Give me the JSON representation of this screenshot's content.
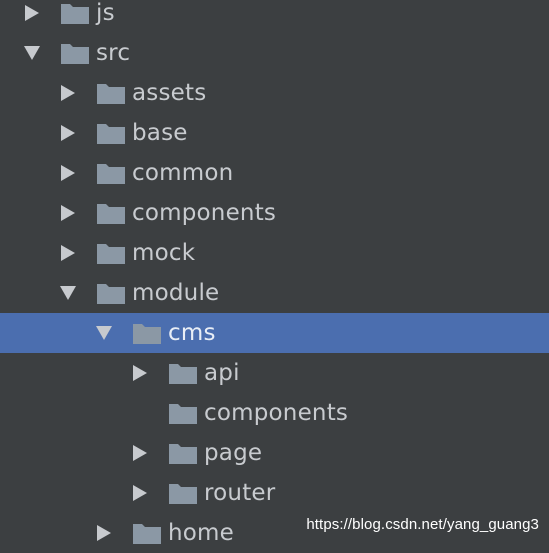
{
  "colors": {
    "background": "#3c3f41",
    "selection": "#4b6eaf",
    "folder": "#8b98a5",
    "arrow": "#c7cace",
    "text": "#c8cbcf"
  },
  "tree": [
    {
      "label": "js",
      "depth": 0,
      "expander": "collapsed",
      "selected": false,
      "icon": "folder-icon"
    },
    {
      "label": "src",
      "depth": 0,
      "expander": "expanded",
      "selected": false,
      "icon": "folder-icon"
    },
    {
      "label": "assets",
      "depth": 1,
      "expander": "collapsed",
      "selected": false,
      "icon": "folder-icon"
    },
    {
      "label": "base",
      "depth": 1,
      "expander": "collapsed",
      "selected": false,
      "icon": "folder-icon"
    },
    {
      "label": "common",
      "depth": 1,
      "expander": "collapsed",
      "selected": false,
      "icon": "folder-icon"
    },
    {
      "label": "components",
      "depth": 1,
      "expander": "collapsed",
      "selected": false,
      "icon": "folder-icon"
    },
    {
      "label": "mock",
      "depth": 1,
      "expander": "collapsed",
      "selected": false,
      "icon": "folder-icon"
    },
    {
      "label": "module",
      "depth": 1,
      "expander": "expanded",
      "selected": false,
      "icon": "folder-icon"
    },
    {
      "label": "cms",
      "depth": 2,
      "expander": "expanded",
      "selected": true,
      "icon": "folder-icon"
    },
    {
      "label": "api",
      "depth": 3,
      "expander": "collapsed",
      "selected": false,
      "icon": "folder-icon"
    },
    {
      "label": "components",
      "depth": 3,
      "expander": "none",
      "selected": false,
      "icon": "folder-icon"
    },
    {
      "label": "page",
      "depth": 3,
      "expander": "collapsed",
      "selected": false,
      "icon": "folder-icon"
    },
    {
      "label": "router",
      "depth": 3,
      "expander": "collapsed",
      "selected": false,
      "icon": "folder-icon"
    },
    {
      "label": "home",
      "depth": 2,
      "expander": "collapsed",
      "selected": false,
      "icon": "folder-icon"
    }
  ],
  "watermark": "https://blog.csdn.net/yang_guang3"
}
